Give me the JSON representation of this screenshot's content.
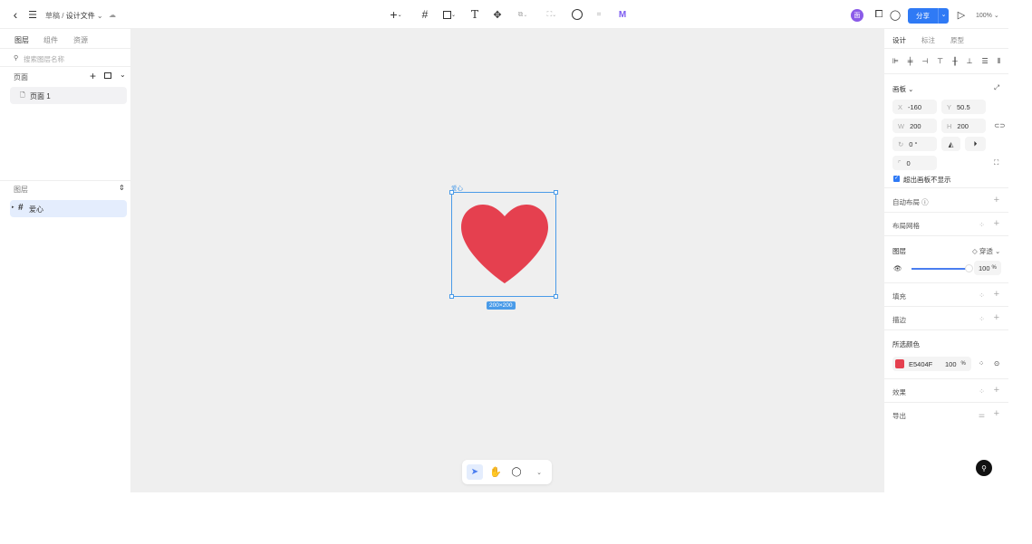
{
  "header": {
    "breadcrumb_root": "草稿",
    "breadcrumb_sep": "/",
    "file_name": "设计文件",
    "share": "分享",
    "zoom": "100%",
    "avatar": "面"
  },
  "left": {
    "tabs": [
      "图层",
      "组件",
      "资源"
    ],
    "search_placeholder": "搜索图层名称",
    "pages_title": "页面",
    "pages": [
      "页面 1"
    ],
    "layers_title": "图层",
    "layers": [
      "爱心"
    ]
  },
  "canvas": {
    "frame_label": "爱心",
    "size_badge": "200×200",
    "heart_color": "#E5404F",
    "selection_color": "#4a9be8"
  },
  "right": {
    "tabs": [
      "设计",
      "标注",
      "原型"
    ],
    "frame_title": "画板",
    "x_label": "X",
    "x": "-160",
    "y_label": "Y",
    "y": "50.5",
    "w_label": "W",
    "w": "200",
    "h_label": "H",
    "h": "200",
    "rotation": "0 °",
    "radius": "0",
    "clip_label": "超出画板不显示",
    "auto_layout": "自动布局",
    "layout_grid": "布局网格",
    "layer_title": "图层",
    "blend_mode": "穿透",
    "opacity": "100",
    "opacity_unit": "%",
    "opacity_fraction": 1.0,
    "fill": "填充",
    "stroke": "描边",
    "selected_colors": "所选颜色",
    "color_hex": "E5404F",
    "color_opacity": "100",
    "effects": "效果",
    "export": "导出"
  }
}
